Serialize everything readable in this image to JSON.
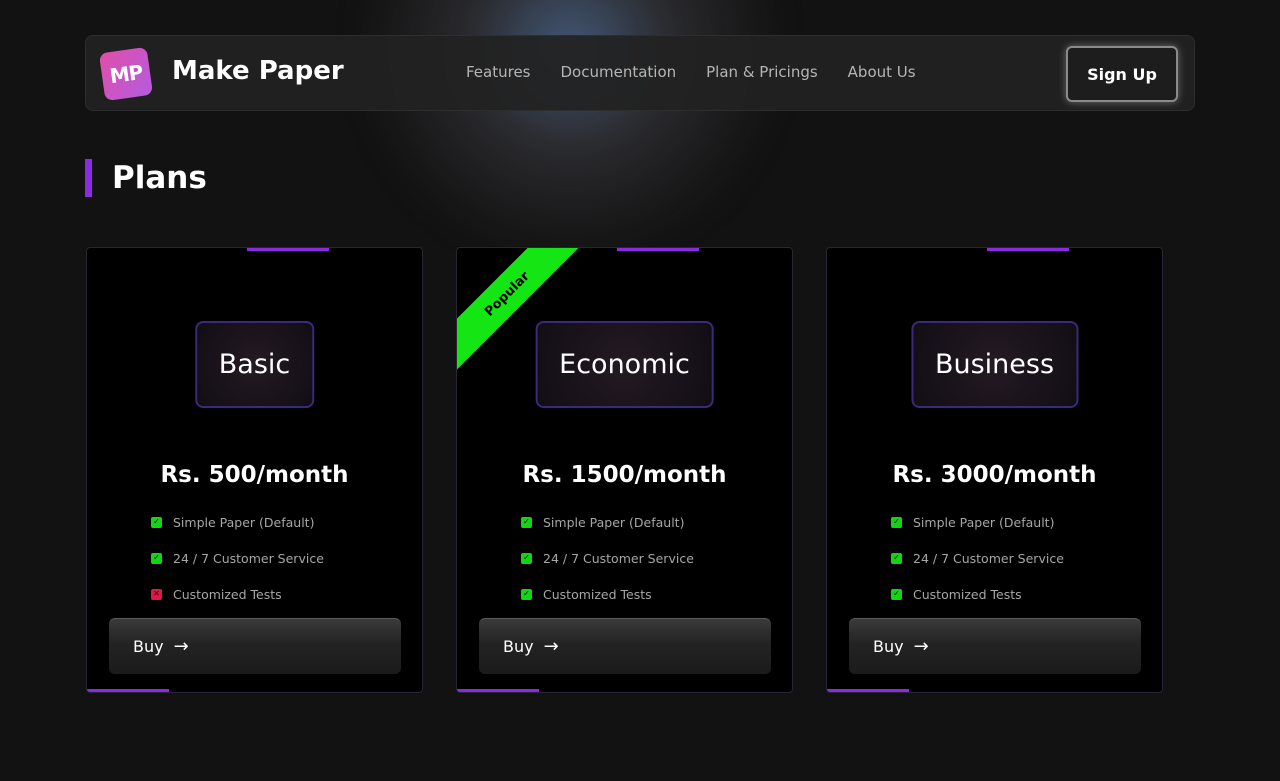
{
  "header": {
    "logo_text": "MP",
    "brand": "Make Paper",
    "nav": [
      "Features",
      "Documentation",
      "Plan & Pricings",
      "About Us"
    ],
    "signup_label": "Sign Up"
  },
  "page": {
    "heading": "Plans"
  },
  "plans": [
    {
      "name": "Basic",
      "price": "Rs. 500/month",
      "ribbon": "",
      "features": [
        {
          "label": "Simple Paper (Default)",
          "included": true
        },
        {
          "label": "24 / 7 Customer Service",
          "included": true
        },
        {
          "label": "Customized Tests",
          "included": false
        }
      ],
      "buy_label": "Buy"
    },
    {
      "name": "Economic",
      "price": "Rs. 1500/month",
      "ribbon": "Popular",
      "features": [
        {
          "label": "Simple Paper (Default)",
          "included": true
        },
        {
          "label": "24 / 7 Customer Service",
          "included": true
        },
        {
          "label": "Customized Tests",
          "included": true
        }
      ],
      "buy_label": "Buy"
    },
    {
      "name": "Business",
      "price": "Rs. 3000/month",
      "ribbon": "",
      "features": [
        {
          "label": "Simple Paper (Default)",
          "included": true
        },
        {
          "label": "24 / 7 Customer Service",
          "included": true
        },
        {
          "label": "Customized Tests",
          "included": true
        }
      ],
      "buy_label": "Buy"
    }
  ],
  "colors": {
    "accent": "#8a2be2",
    "check_ok": "#12d612",
    "check_no": "#e0184a",
    "ribbon": "#14e614"
  },
  "icons": {
    "check": "check-icon",
    "cross": "cross-icon",
    "arrow": "arrow-right-icon"
  }
}
